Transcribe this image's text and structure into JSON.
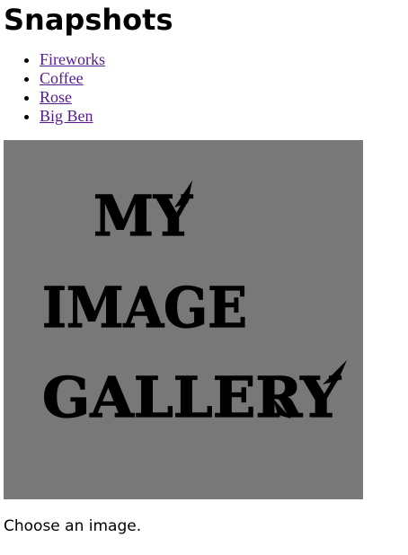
{
  "page": {
    "title": "Snapshots"
  },
  "gallery": {
    "links": [
      {
        "label": "Fireworks"
      },
      {
        "label": "Coffee"
      },
      {
        "label": "Rose"
      },
      {
        "label": "Big Ben"
      }
    ],
    "image": {
      "lines": [
        "MY",
        "IMAGE",
        "GALLERY"
      ],
      "background": "#787878",
      "text_color": "#000000"
    },
    "placeholder": "Choose an image."
  },
  "colors": {
    "link_visited": "#551a8b"
  }
}
